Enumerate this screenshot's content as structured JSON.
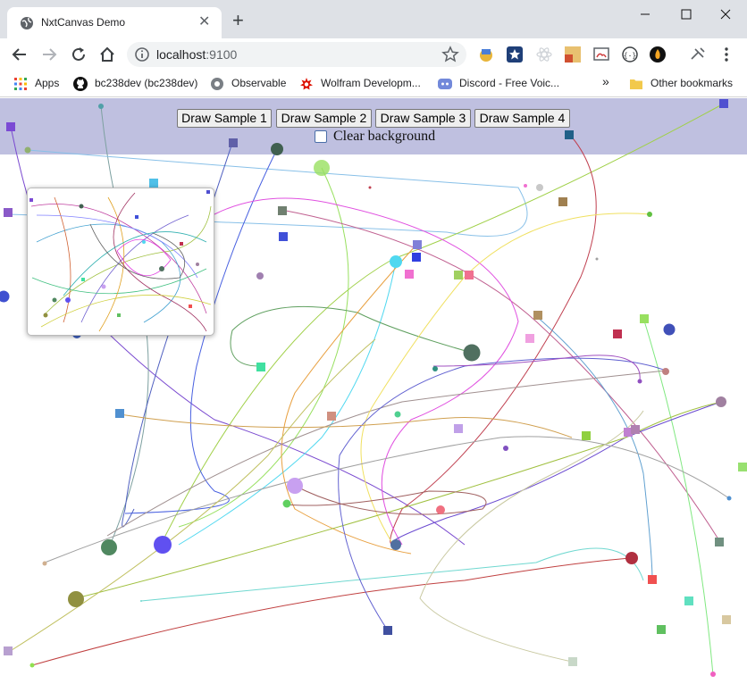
{
  "browser": {
    "tab_title": "NxtCanvas Demo",
    "url_host": "localhost",
    "url_port": ":9100",
    "new_tab_symbol": "+",
    "close_symbol": "✕"
  },
  "bookmarks": {
    "items": [
      {
        "label": "Apps",
        "icon": "apps-grid-icon"
      },
      {
        "label": "bc238dev (bc238dev)",
        "icon": "github-icon"
      },
      {
        "label": "Observable",
        "icon": "observable-icon"
      },
      {
        "label": "Wolfram Developm...",
        "icon": "wolfram-icon"
      },
      {
        "label": "Discord - Free Voic...",
        "icon": "discord-icon"
      }
    ],
    "overflow": "»",
    "other": "Other bookmarks"
  },
  "controls": {
    "buttons": [
      "Draw Sample 1",
      "Draw Sample 2",
      "Draw Sample 3",
      "Draw Sample 4"
    ],
    "clear_label": "Clear background",
    "clear_checked": false,
    "bar_color": "#bfc0e0"
  }
}
